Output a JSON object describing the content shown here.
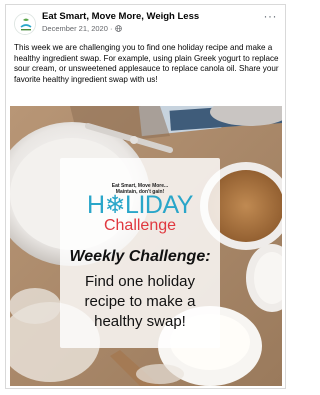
{
  "post": {
    "page_name": "Eat Smart, Move More, Weigh Less",
    "date": "December 21, 2020 ·",
    "more_label": "···",
    "caption": "This week we are challenging you to find one holiday recipe and make a healthy ingredient swap. For example, using plain Greek yogurt to replace sour cream, or unsweetened applesauce to replace canola oil. Share your favorite healthy ingredient swap with us!"
  },
  "image": {
    "tagline_1": "Eat Smart, Move More...",
    "tagline_2": "Maintain, don't gain!",
    "holiday": "H❄LIDAY",
    "challenge": "Challenge",
    "weekly": "Weekly Challenge:",
    "line_1": "Find one holiday",
    "line_2": "recipe to make a",
    "line_3": "healthy swap!"
  },
  "colors": {
    "holiday_blue": "#2aa6c9",
    "challenge_red": "#e0383f"
  },
  "icons": {
    "globe": "globe-icon",
    "more": "more-options-icon"
  }
}
